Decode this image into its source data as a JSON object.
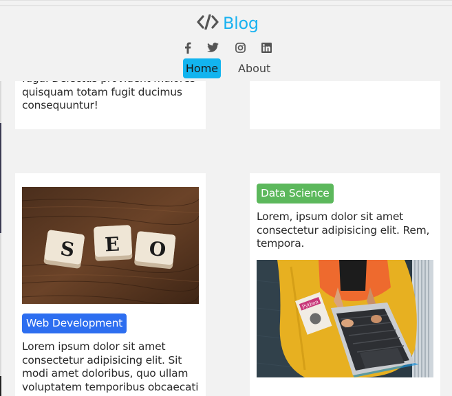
{
  "header": {
    "brand": "Blog",
    "icons": [
      "code-icon",
      "facebook-icon",
      "twitter-icon",
      "instagram-icon",
      "linkedin-icon"
    ],
    "nav": [
      {
        "label": "Home",
        "active": true
      },
      {
        "label": "About",
        "active": false
      }
    ],
    "colors": {
      "brand": "#1ab2f0",
      "active_nav": "#12b4ef",
      "icon": "#555555"
    }
  },
  "posts": [
    {
      "text": "fuga. Delectus provident maiores quisquam totam fugit ducimus consequuntur!"
    },
    {
      "text": ""
    },
    {
      "category": "Web Development",
      "category_color": "#2d6ef0",
      "image_alt": "SEO scrabble tiles",
      "tiles": [
        "S",
        "E",
        "O"
      ],
      "text": "Lorem ipsum dolor sit amet consectetur adipisicing elit. Sit modi amet doloribus, quo ullam voluptatem temporibus obcaecati"
    },
    {
      "category": "Data Science",
      "category_color": "#5cb85c",
      "text": "Lorem, ipsum dolor sit amet consectetur adipisicing elit. Rem, tempora.",
      "image_alt": "person using laptop with Python book",
      "book_title": "Python"
    }
  ]
}
